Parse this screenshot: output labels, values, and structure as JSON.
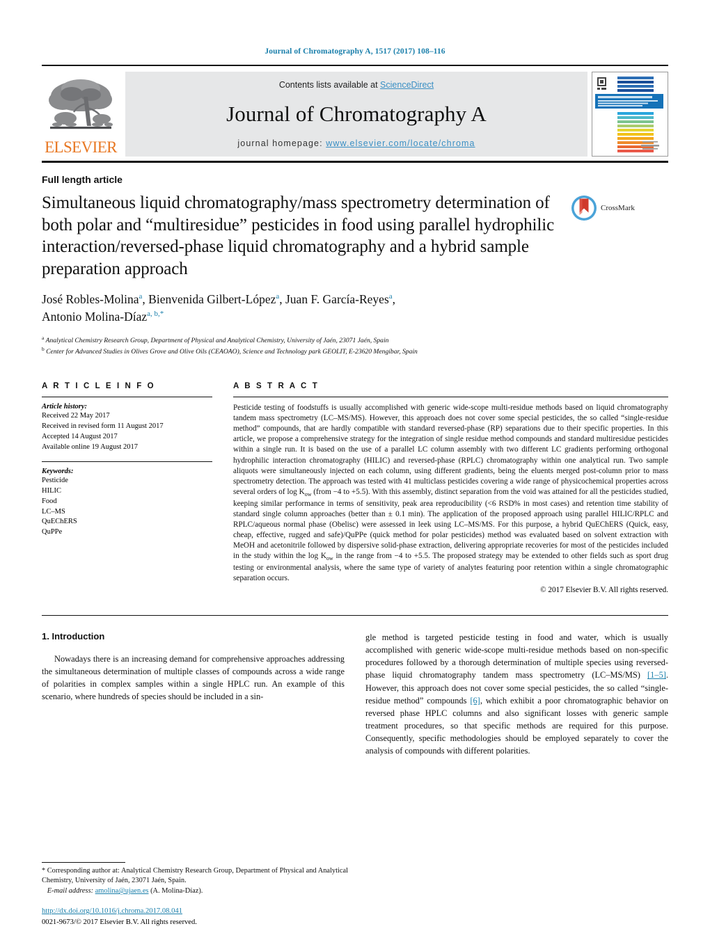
{
  "running_head": "Journal of Chromatography A, 1517 (2017) 108–116",
  "masthead": {
    "contents_prefix": "Contents lists available at ",
    "sciencedirect": "ScienceDirect",
    "journal_title": "Journal of Chromatography A",
    "homepage_prefix": "journal homepage: ",
    "homepage_url": "www.elsevier.com/locate/chroma",
    "publisher": "ELSEVIER",
    "cover_title": "JOURNAL OF CHROMATOGRAPHY A",
    "cover_subtitle": "Including Electrophoresis and other separation methods"
  },
  "colors": {
    "link": "#1a7fab",
    "sciencedirect": "#3a8fc4",
    "elsevier_orange": "#E87722",
    "banner_bg": "#e6e7e8",
    "cover_band": "#1572b8"
  },
  "article_type": "Full length article",
  "title": "Simultaneous liquid chromatography/mass spectrometry determination of both polar and “multiresidue” pesticides in food using parallel hydrophilic interaction/reversed-phase liquid chromatography and a hybrid sample preparation approach",
  "crossmark_label": "CrossMark",
  "authors": [
    {
      "name": "José Robles-Molina",
      "marks": "a",
      "sep": ", "
    },
    {
      "name": "Bienvenida Gilbert-López",
      "marks": "a",
      "sep": ", "
    },
    {
      "name": "Juan F. García-Reyes",
      "marks": "a",
      "sep": ", "
    },
    {
      "name": "Antonio Molina-Díaz",
      "marks": "a, b,",
      "star": "*",
      "sep": ""
    }
  ],
  "affiliations": [
    {
      "mark": "a",
      "text": "Analytical Chemistry Research Group, Department of Physical and Analytical Chemistry, University of Jaén, 23071 Jaén, Spain"
    },
    {
      "mark": "b",
      "text": "Center for Advanced Studies in Olives Grove and Olive Oils (CEAOAO), Science and Technology park GEOLIT, E-23620 Mengíbar, Spain"
    }
  ],
  "article_info": {
    "heading": "A R T I C L E   I N F O",
    "history_label": "Article history:",
    "history": [
      "Received 22 May 2017",
      "Received in revised form 11 August 2017",
      "Accepted 14 August 2017",
      "Available online 19 August 2017"
    ],
    "keywords_label": "Keywords:",
    "keywords": [
      "Pesticide",
      "HILIC",
      "Food",
      "LC–MS",
      "QuEChERS",
      "QuPPe"
    ]
  },
  "abstract": {
    "heading": "A B S T R A C T",
    "part1": "Pesticide testing of foodstuffs is usually accomplished with generic wide-scope multi-residue methods based on liquid chromatography tandem mass spectrometry (LC–MS/MS). However, this approach does not cover some special pesticides, the so called “single-residue method” compounds, that are hardly compatible with standard reversed-phase (RP) separations due to their specific properties. In this article, we propose a comprehensive strategy for the integration of single residue method compounds and standard multiresidue pesticides within a single run. It is based on the use of a parallel LC column assembly with two different LC gradients performing orthogonal hydrophilic interaction chromatography (HILIC) and reversed-phase (RPLC) chromatography within one analytical run. Two sample aliquots were simultaneously injected on each column, using different gradients, being the eluents merged post-column prior to mass spectrometry detection. The approach was tested with 41 multiclass pesticides covering a wide range of physicochemical properties across several orders of log K",
    "sub1": "ow",
    "part2": " (from −4 to +5.5). With this assembly, distinct separation from the void was attained for all the pesticides studied, keeping similar performance in terms of sensitivity, peak area reproducibility (<6 RSD% in most cases) and retention time stability of standard single column approaches (better than ± 0.1 min). The application of the proposed approach using parallel HILIC/RPLC and RPLC/aqueous normal phase (Obelisc) were assessed in leek using LC–MS/MS. For this purpose, a hybrid QuEChERS (Quick, easy, cheap, effective, rugged and safe)/QuPPe (quick method for polar pesticides) method was evaluated based on solvent extraction with MeOH and acetonitrile followed by dispersive solid-phase extraction, delivering appropriate recoveries for most of the pesticides included in the study within the log K",
    "sub2": "ow",
    "part3": " in the range from −4 to +5.5. The proposed strategy may be extended to other fields such as sport drug testing or environmental analysis, where the same type of variety of analytes featuring poor retention within a single chromatographic separation occurs.",
    "copyright": "© 2017 Elsevier B.V. All rights reserved."
  },
  "introduction": {
    "section_number_title": "1.  Introduction",
    "left_paragraph": "Nowadays there is an increasing demand for comprehensive approaches addressing the simultaneous determination of multiple classes of compounds across a wide range of polarities in complex samples within a single HPLC run. An example of this scenario, where hundreds of species should be included in a sin-",
    "right_part1": "gle method is targeted pesticide testing in food and water, which is usually accomplished with generic wide-scope multi-residue methods based on non-specific procedures followed by a thorough determination of multiple species using reversed-phase liquid chromatography tandem mass spectrometry (LC–MS/MS) ",
    "right_ref1": "[1–5]",
    "right_part2": ". However, this approach does not cover some special pesticides, the so called “single-residue method” compounds ",
    "right_ref2": "[6]",
    "right_part3": ", which exhibit a poor chromatographic behavior on reversed phase HPLC columns and also significant losses with generic sample treatment procedures, so that specific methods are required for this purpose. Consequently, specific methodologies should be employed separately to cover the analysis of compounds with different polarities."
  },
  "footnote": {
    "star": "*",
    "text": " Corresponding author at: Analytical Chemistry Research Group, Department of Physical and Analytical Chemistry, University of Jaén, 23071 Jaén, Spain.",
    "email_label": "E-mail address:",
    "email": "amolina@ujaen.es",
    "email_owner": "(A. Molina-Díaz)."
  },
  "doi_block": {
    "doi": "http://dx.doi.org/10.1016/j.chroma.2017.08.041",
    "issn_line": "0021-9673/© 2017 Elsevier B.V. All rights reserved."
  }
}
